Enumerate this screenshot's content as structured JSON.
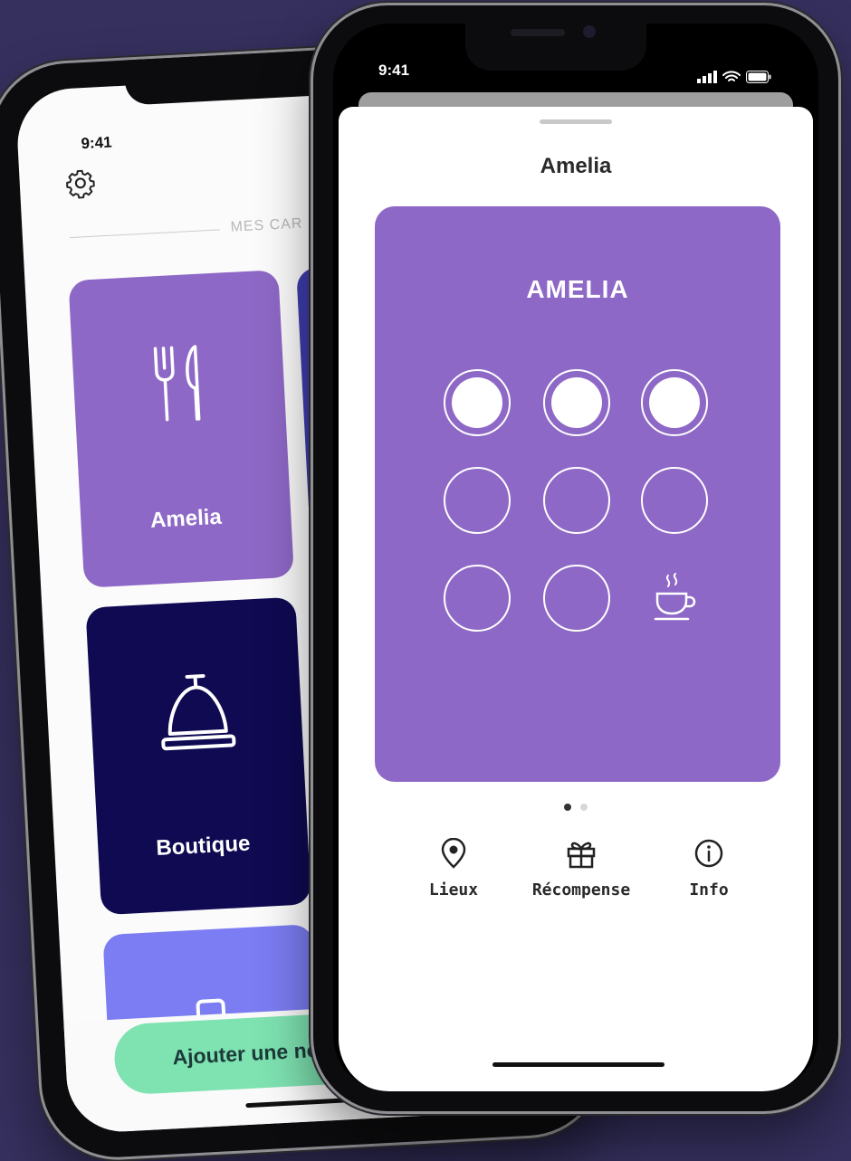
{
  "back_phone": {
    "status_time": "9:41",
    "section_label": "MES CAR",
    "tiles": [
      {
        "label": "Amelia",
        "color": "#8e68c6",
        "icon": "utensils-icon"
      },
      {
        "label": "Boutique",
        "color": "#0f0a52",
        "icon": "service-bell-icon"
      },
      {
        "label": "",
        "color": "#7c7cf3",
        "icon": "bag-icon"
      }
    ],
    "side_tile_colors": [
      "#3e3dac",
      "#c9593d",
      "#0d6c5a"
    ],
    "add_button_label": "Ajouter une nou"
  },
  "front_phone": {
    "status_time": "9:41",
    "sheet_title": "Amelia",
    "card": {
      "title": "AMELIA",
      "color": "#8e68c6",
      "stamps_filled": 3,
      "stamps_total": 8,
      "reward_icon": "coffee-cup-icon"
    },
    "pager": {
      "pages": 2,
      "current": 1
    },
    "actions": [
      {
        "label": "Lieux",
        "icon": "location-pin-icon"
      },
      {
        "label": "Récompense",
        "icon": "gift-icon"
      },
      {
        "label": "Info",
        "icon": "info-icon"
      }
    ]
  },
  "colors": {
    "background": "#35305e",
    "add_button": "#7ee2b1"
  }
}
